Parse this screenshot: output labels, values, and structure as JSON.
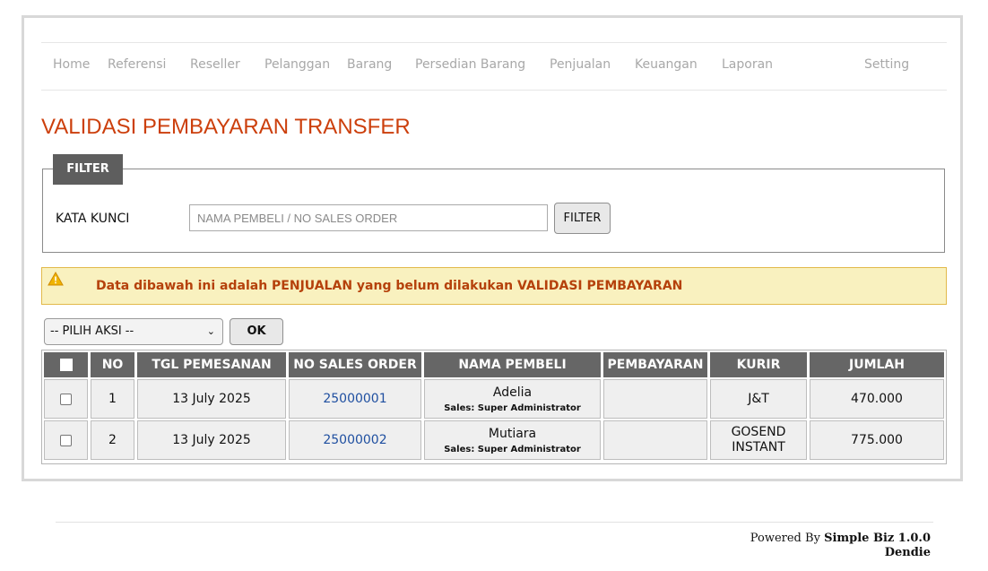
{
  "nav": {
    "items": [
      "Home",
      "Referensi",
      "Reseller",
      "Pelanggan",
      "Barang",
      "Persedian Barang",
      "Penjualan",
      "Keuangan",
      "Laporan"
    ],
    "setting": "Setting"
  },
  "page": {
    "title": "VALIDASI PEMBAYARAN TRANSFER"
  },
  "filter": {
    "legend": "FILTER",
    "label": "KATA KUNCI",
    "placeholder": "NAMA PEMBELI / NO SALES ORDER",
    "button": "FILTER"
  },
  "alert": {
    "icon": "warning-icon",
    "text": "Data dibawah ini adalah PENJUALAN yang belum dilakukan VALIDASI PEMBAYARAN"
  },
  "actions": {
    "select_value": "-- PILIH AKSI --",
    "ok": "OK"
  },
  "table": {
    "headers": [
      "NO",
      "TGL PEMESANAN",
      "NO SALES ORDER",
      "NAMA PEMBELI",
      "PEMBAYARAN",
      "KURIR",
      "JUMLAH"
    ],
    "rows": [
      {
        "no": "1",
        "tgl": "13 July 2025",
        "so": "25000001",
        "nama": "Adelia",
        "sales": "Sales: Super Administrator",
        "pembayaran": "",
        "kurir": "J&T",
        "jumlah": "470.000"
      },
      {
        "no": "2",
        "tgl": "13 July 2025",
        "so": "25000002",
        "nama": "Mutiara",
        "sales": "Sales: Super Administrator",
        "pembayaran": "",
        "kurir": "GOSEND INSTANT",
        "jumlah": "775.000"
      }
    ]
  },
  "footer": {
    "powered": "Powered By",
    "product": "Simple Biz 1.0.0",
    "author": "Dendie"
  },
  "colors": {
    "title": "#cc3f0c",
    "alert_bg": "#f9f1bf",
    "alert_text": "#b5410b",
    "header_bg": "#666666",
    "link": "#1f4fa0"
  }
}
